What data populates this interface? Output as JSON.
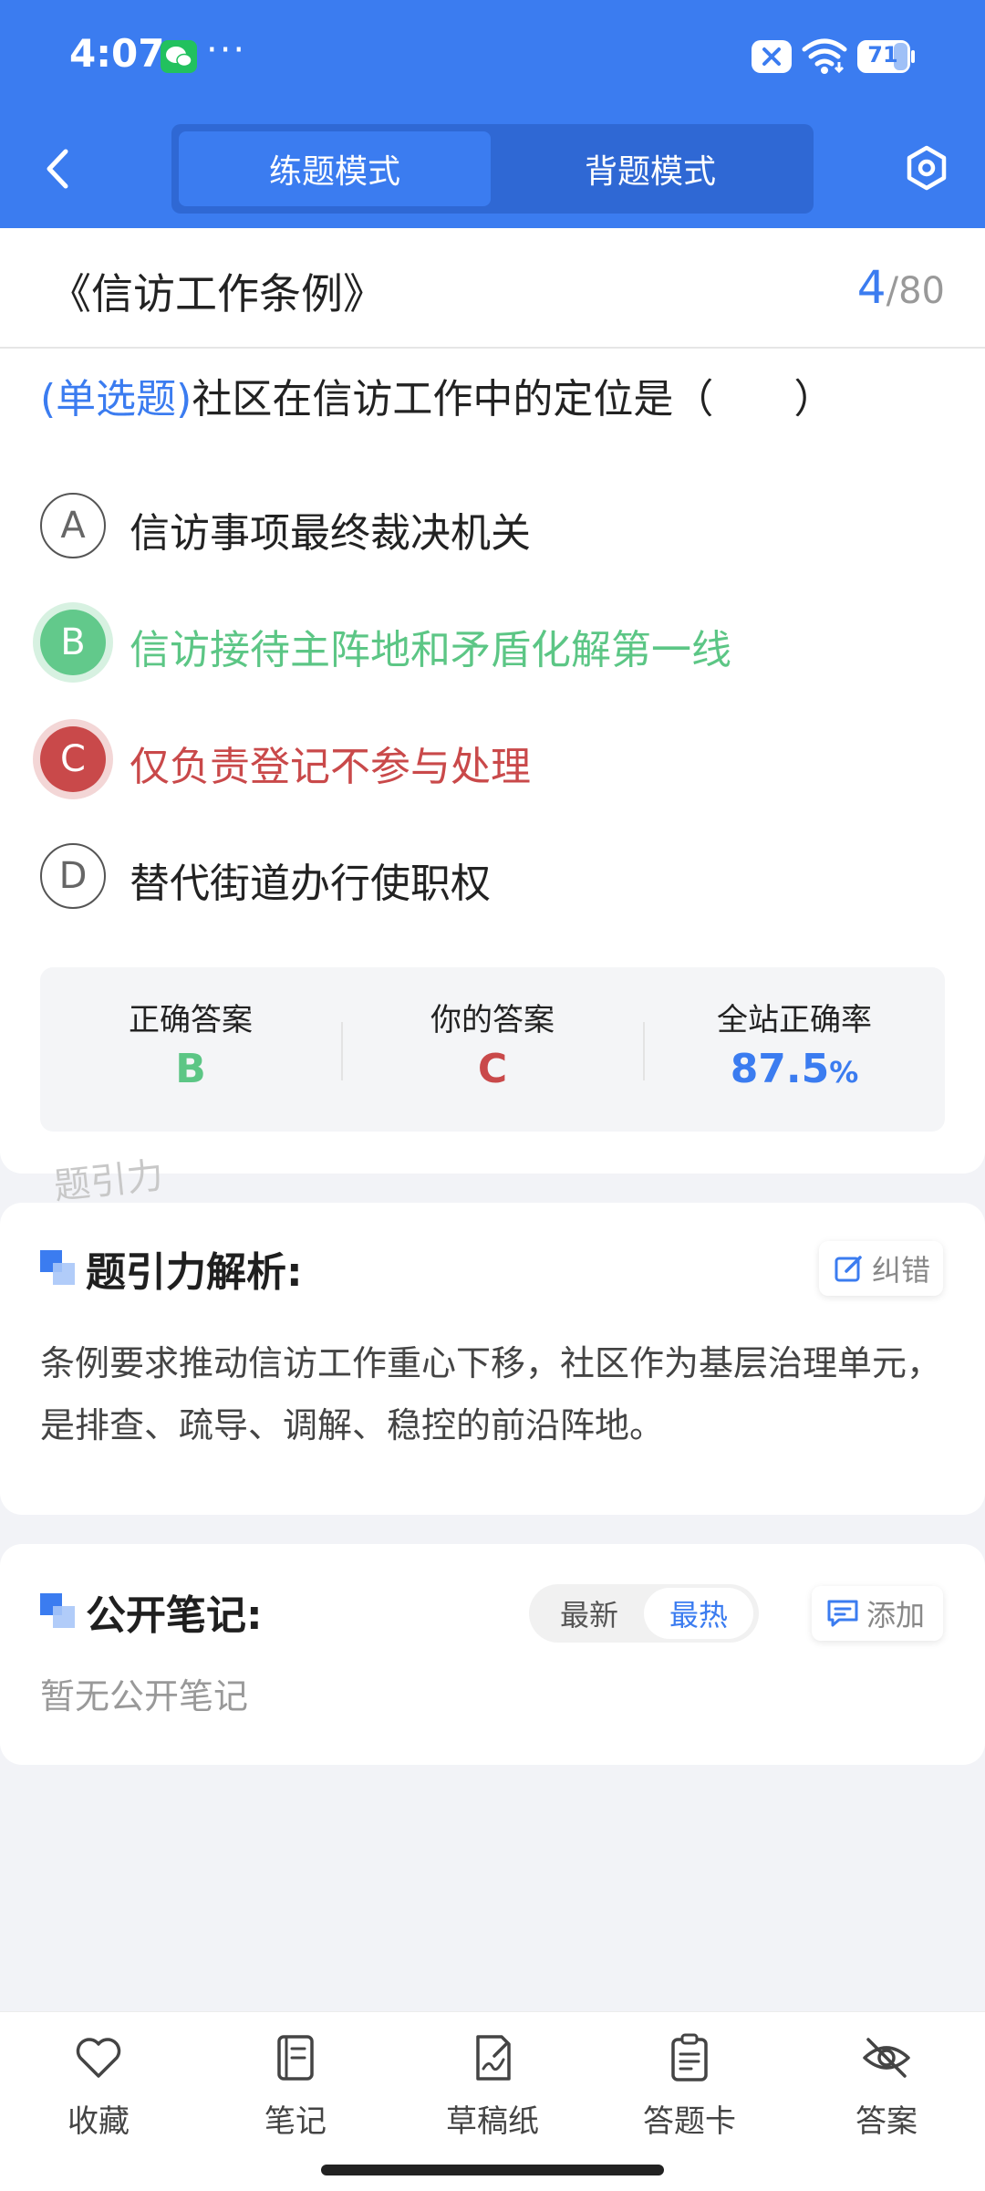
{
  "status_bar": {
    "time": "4:07",
    "more": "···",
    "battery": "71"
  },
  "header": {
    "modes": [
      "练题模式",
      "背题模式"
    ],
    "active_mode": "练题模式",
    "accent_color": "#3b7cf0"
  },
  "title_bar": {
    "title": "《信访工作条例》",
    "current": "4",
    "separator": "/",
    "total": "80"
  },
  "question": {
    "type_label": "(单选题)",
    "text": "社区在信访工作中的定位是（　　）",
    "options": [
      {
        "letter": "A",
        "text": "信访事项最终裁决机关",
        "state": "normal"
      },
      {
        "letter": "B",
        "text": "信访接待主阵地和矛盾化解第一线",
        "state": "correct"
      },
      {
        "letter": "C",
        "text": "仅负责登记不参与处理",
        "state": "wrong"
      },
      {
        "letter": "D",
        "text": "替代街道办行使职权",
        "state": "normal"
      }
    ]
  },
  "answer_summary": {
    "correct_label": "正确答案",
    "correct_value": "B",
    "yours_label": "你的答案",
    "yours_value": "C",
    "rate_label": "全站正确率",
    "rate_value": "87.5",
    "rate_unit": "%",
    "colors": {
      "correct": "#5cc685",
      "wrong": "#c9494a"
    }
  },
  "watermark": "题引力",
  "analysis": {
    "title": "题引力解析:",
    "report_label": "纠错",
    "body": "条例要求推动信访工作重心下移，社区作为基层治理单元，是排查、疏导、调解、稳控的前沿阵地。"
  },
  "notes": {
    "title": "公开笔记:",
    "sort_options": [
      "最新",
      "最热"
    ],
    "active_sort": "最热",
    "add_label": "添加",
    "empty_text": "暂无公开笔记"
  },
  "bottom_nav": [
    {
      "label": "收藏",
      "icon": "heart-icon"
    },
    {
      "label": "笔记",
      "icon": "notebook-icon"
    },
    {
      "label": "草稿纸",
      "icon": "draft-icon"
    },
    {
      "label": "答题卡",
      "icon": "clipboard-icon"
    },
    {
      "label": "答案",
      "icon": "eye-off-icon"
    }
  ]
}
